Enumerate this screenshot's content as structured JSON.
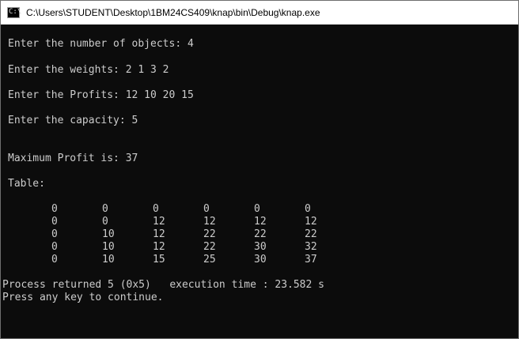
{
  "window": {
    "title": "C:\\Users\\STUDENT\\Desktop\\1BM24CS409\\knap\\bin\\Debug\\knap.exe",
    "icon": "console-app-icon"
  },
  "console": {
    "lines": [
      "Enter the number of objects: 4",
      "Enter the weights: 2 1 3 2",
      "Enter the Profits: 12 10 20 15",
      "Enter the capacity: 5",
      "Maximum Profit is: 37",
      "Table:"
    ],
    "table": [
      [
        "0",
        "0",
        "0",
        "0",
        "0",
        "0"
      ],
      [
        "0",
        "0",
        "12",
        "12",
        "12",
        "12"
      ],
      [
        "0",
        "10",
        "12",
        "22",
        "22",
        "22"
      ],
      [
        "0",
        "10",
        "12",
        "22",
        "30",
        "32"
      ],
      [
        "0",
        "10",
        "15",
        "25",
        "30",
        "37"
      ]
    ],
    "footer": [
      "Process returned 5 (0x5)   execution time : 23.582 s",
      "Press any key to continue."
    ]
  }
}
